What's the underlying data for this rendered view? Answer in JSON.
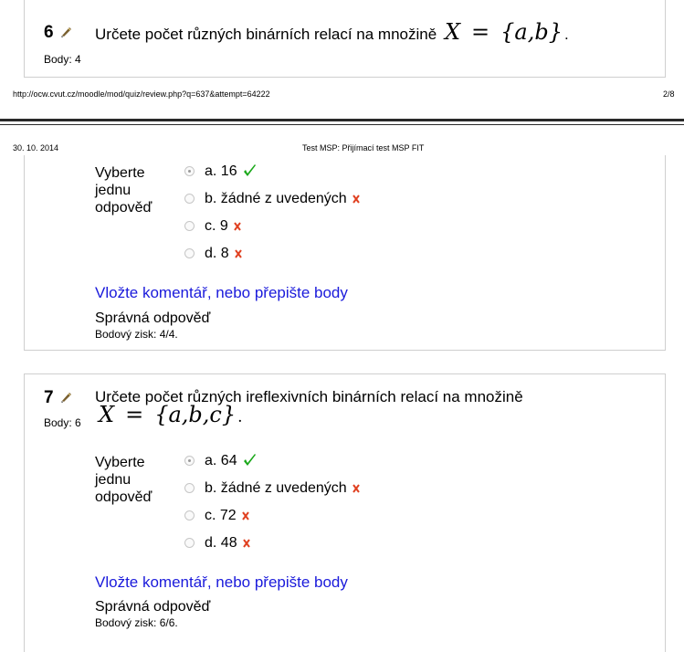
{
  "page_header": {
    "url": "http://ocw.cvut.cz/moodle/mod/quiz/review.php?q=637&attempt=64222",
    "page_number": "2/8",
    "date": "30. 10. 2014",
    "doc_title": "Test MSP: Přijímací test MSP FIT"
  },
  "q6": {
    "number": "6",
    "text": "Určete počet různých binárních relací na množině",
    "math_var": "X",
    "math_set": "{a,b}",
    "math_end": ".",
    "points_label": "Body: 4",
    "prompt_line1": "Vyberte",
    "prompt_line2": "jednu",
    "prompt_line3": "odpověď",
    "options": [
      {
        "label": "a. 16",
        "selected": true,
        "correct": true
      },
      {
        "label": "b. žádné z uvedených",
        "selected": false,
        "correct": false
      },
      {
        "label": "c. 9",
        "selected": false,
        "correct": false
      },
      {
        "label": "d. 8",
        "selected": false,
        "correct": false
      }
    ],
    "comment_link": "Vložte komentář, nebo přepište body",
    "status": "Správná odpověď",
    "score": "Bodový zisk: 4/4."
  },
  "q7": {
    "number": "7",
    "text": "Určete počet různých ireflexivních binárních relací na množině",
    "math_var": "X",
    "math_set": "{a,b,c}",
    "math_end": ".",
    "points_label": "Body: 6",
    "prompt_line1": "Vyberte",
    "prompt_line2": "jednu",
    "prompt_line3": "odpověď",
    "options": [
      {
        "label": "a. 64",
        "selected": true,
        "correct": true
      },
      {
        "label": "b. žádné z uvedených",
        "selected": false,
        "correct": false
      },
      {
        "label": "c. 72",
        "selected": false,
        "correct": false
      },
      {
        "label": "d. 48",
        "selected": false,
        "correct": false
      }
    ],
    "comment_link": "Vložte komentář, nebo přepište body",
    "status": "Správná odpověď",
    "score": "Bodový zisk: 6/6."
  },
  "colors": {
    "link": "#1a1adb",
    "correct": "#1aa81a",
    "wrong": "#e04020"
  },
  "icons": {
    "edit": "edit-icon",
    "correct": "check-icon",
    "wrong": "cross-icon"
  }
}
